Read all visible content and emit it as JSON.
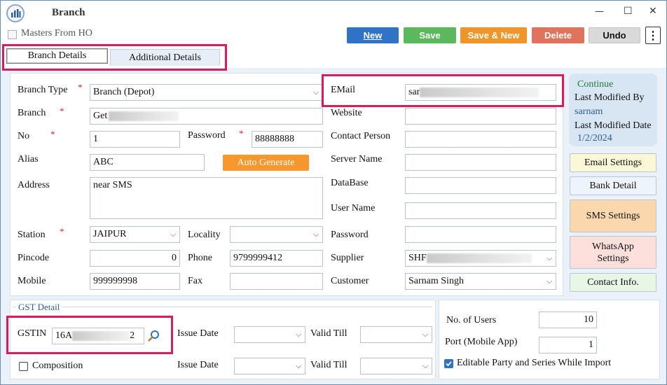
{
  "window": {
    "title": "Branch",
    "minimize": "—",
    "maximize": "☐",
    "close": "✕"
  },
  "toolbar": {
    "masters_from_ho": "Masters From HO",
    "new": "New",
    "save": "Save",
    "save_new": "Save & New",
    "delete": "Delete",
    "undo": "Undo",
    "more": "⋮"
  },
  "tabs": [
    {
      "label": "Branch Details"
    },
    {
      "label": "Additional Details"
    }
  ],
  "form": {
    "branch_type_label": "Branch Type",
    "branch_type_value": "Branch (Depot)",
    "branch_label": "Branch",
    "branch_value": "Get",
    "no_label": "No",
    "no_value": "1",
    "password_label": "Password",
    "password_value": "88888888",
    "alias_label": "Alias",
    "alias_value": "ABC",
    "auto_generate": "Auto Generate",
    "address_label": "Address",
    "address_value": "near SMS",
    "station_label": "Station",
    "station_value": "JAIPUR",
    "locality_label": "Locality",
    "locality_value": "",
    "pincode_label": "Pincode",
    "pincode_value": "0",
    "phone_label": "Phone",
    "phone_value": "9799999412",
    "mobile_label": "Mobile",
    "mobile_value": "999999998",
    "fax_label": "Fax",
    "fax_value": "",
    "email_label": "EMail",
    "email_value": "sar",
    "website_label": "Website",
    "contact_person_label": "Contact Person",
    "server_name_label": "Server Name",
    "database_label": "DataBase",
    "user_name_label": "User Name",
    "password2_label": "Password",
    "supplier_label": "Supplier",
    "supplier_value": "SHF",
    "customer_label": "Customer",
    "customer_value": "Sarnam Singh"
  },
  "info": {
    "status": "Continue",
    "last_modified_by_label": "Last Modified By",
    "last_modified_by": "sarnam",
    "last_modified_date_label": "Last Modified Date",
    "last_modified_date": "1/2/2024"
  },
  "side_buttons": {
    "email_settings": "Email Settings",
    "bank_detail": "Bank Detail",
    "sms_settings": "SMS Settings",
    "whatsapp_1": "WhatsApp",
    "whatsapp_2": "Settings",
    "contact_info": "Contact Info."
  },
  "gst": {
    "legend": "GST Detail",
    "gstin_label": "GSTIN",
    "gstin_prefix": "16A",
    "gstin_suffix": "2",
    "issue_date_label": "Issue Date",
    "valid_till_label": "Valid Till",
    "composition_label": "Composition",
    "issue_date_label2": "Issue Date",
    "valid_till_label2": "Valid Till"
  },
  "users": {
    "no_of_users_label": "No. of Users",
    "no_of_users": "10",
    "port_label": "Port (Mobile App)",
    "port": "1",
    "editable_label": "Editable Party and Series While Import"
  },
  "colors": {
    "new": "#2f72c6",
    "save": "#5cb85c",
    "save_new": "#f0952a",
    "delete": "#e0735e",
    "undo": "#d9d9d9",
    "highlight": "#e0195a"
  }
}
